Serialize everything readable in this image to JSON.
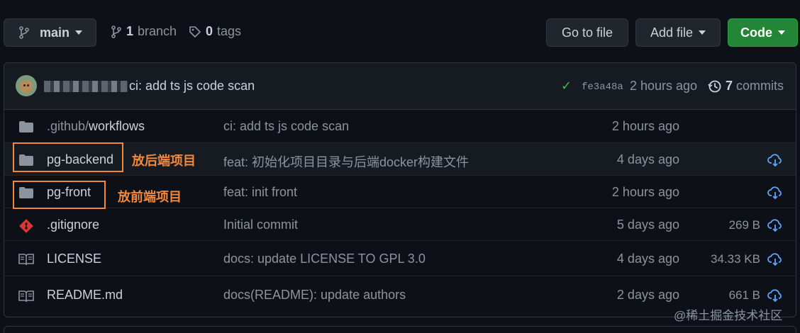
{
  "toolbar": {
    "branch_label": "main",
    "branch_count": "1",
    "branch_word": "branch",
    "tag_count": "0",
    "tag_word": "tags",
    "goto_file": "Go to file",
    "add_file": "Add file",
    "code": "Code"
  },
  "commit": {
    "message": "ci: add ts js code scan",
    "sha": "fe3a48a",
    "time": "2 hours ago",
    "commit_count": "7",
    "commit_word": "commits"
  },
  "files": [
    {
      "type": "folder",
      "name_prefix": ".github/",
      "name": "workflows",
      "message": "ci: add ts js code scan",
      "age": "2 hours ago",
      "size": ""
    },
    {
      "type": "folder",
      "name_prefix": "",
      "name": "pg-backend",
      "message": "feat: 初始化项目目录与后端docker构建文件",
      "age": "4 days ago",
      "size": ""
    },
    {
      "type": "folder",
      "name_prefix": "",
      "name": "pg-front",
      "message": "feat: init front",
      "age": "2 hours ago",
      "size": ""
    },
    {
      "type": "git",
      "name_prefix": "",
      "name": ".gitignore",
      "message": "Initial commit",
      "age": "5 days ago",
      "size": "269 B"
    },
    {
      "type": "book",
      "name_prefix": "",
      "name": "LICENSE",
      "message": "docs: update LICENSE TO GPL 3.0",
      "age": "4 days ago",
      "size": "34.33 KB"
    },
    {
      "type": "book",
      "name_prefix": "",
      "name": "README.md",
      "message": "docs(README): update authors",
      "age": "2 days ago",
      "size": "661 B"
    }
  ],
  "annotations": {
    "backend": "放后端项目",
    "front": "放前端项目"
  },
  "watermark": "@稀土掘金技术社区",
  "colors": {
    "background": "#0d1117",
    "accent_green": "#238636",
    "annotation": "#f0883e",
    "link_blue": "#58a6ff"
  }
}
